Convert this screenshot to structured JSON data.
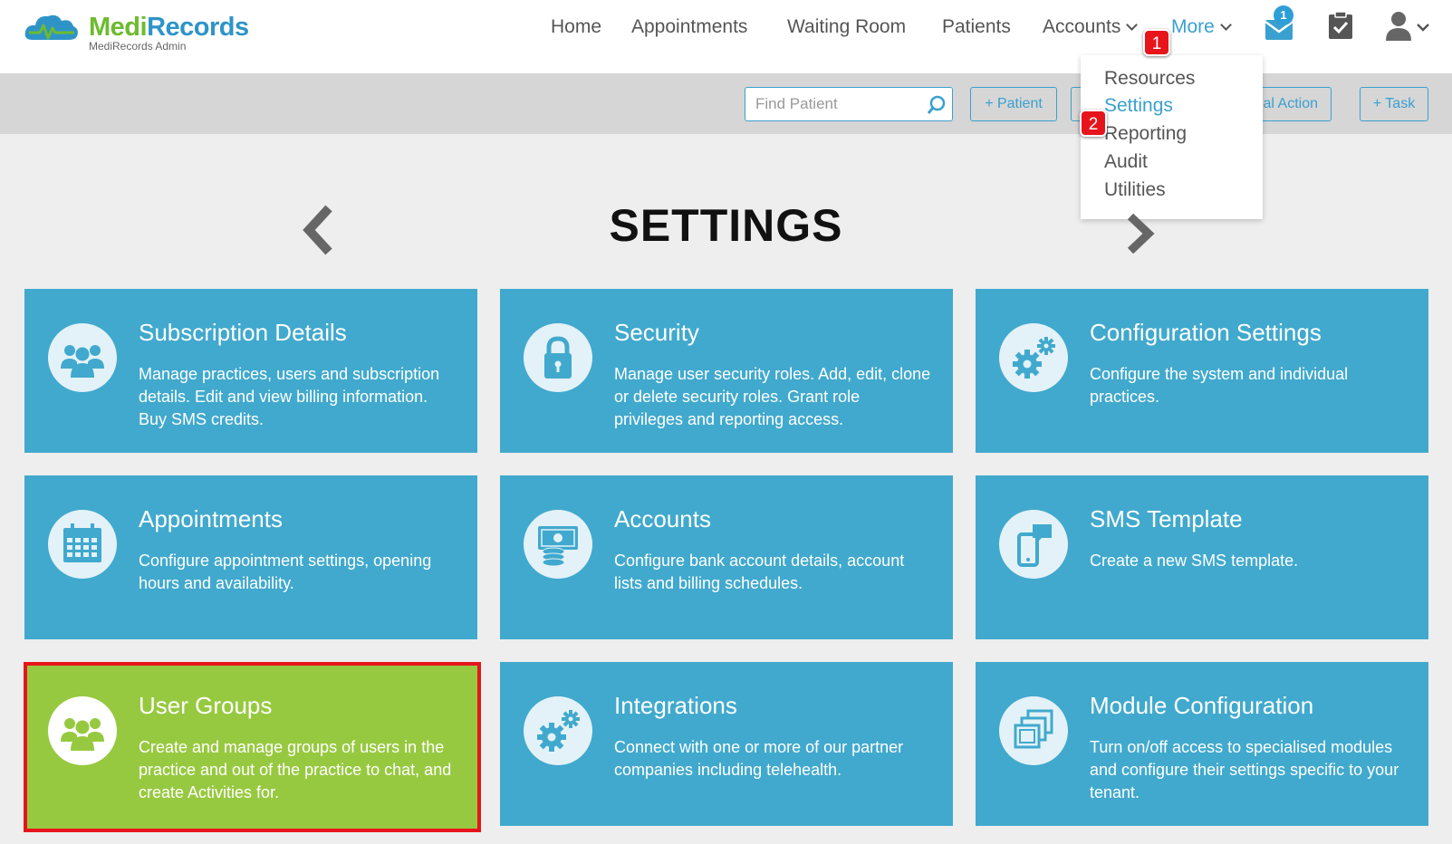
{
  "header": {
    "logo": {
      "name_part1": "Medi",
      "name_part2": "Records",
      "subtitle": "MediRecords Admin"
    },
    "nav": [
      {
        "label": "Home"
      },
      {
        "label": "Appointments"
      },
      {
        "label": "Waiting Room"
      },
      {
        "label": "Patients"
      },
      {
        "label": "Accounts"
      },
      {
        "label": "More",
        "active": true
      }
    ],
    "messages_count": "1",
    "step_badges": [
      "1",
      "2"
    ]
  },
  "toolbar": {
    "search_placeholder": "Find Patient",
    "buttons": [
      {
        "label": "+ Patient"
      },
      {
        "label": "ical Action"
      },
      {
        "label": "+ Task"
      }
    ]
  },
  "dropdown": {
    "items": [
      {
        "label": "Resources"
      },
      {
        "label": "Settings",
        "active": true
      },
      {
        "label": "Reporting"
      },
      {
        "label": "Audit"
      },
      {
        "label": "Utilities"
      }
    ]
  },
  "page": {
    "title": "SETTINGS"
  },
  "cards": [
    {
      "title": "Subscription Details",
      "desc": "Manage practices, users and subscription details. Edit and view billing information. Buy SMS credits.",
      "icon": "users-icon"
    },
    {
      "title": "Security",
      "desc": "Manage user security roles. Add, edit, clone or delete security roles. Grant role privileges and reporting access.",
      "icon": "lock-icon"
    },
    {
      "title": "Configuration Settings",
      "desc": "Configure the system and individual practices.",
      "icon": "gears-icon"
    },
    {
      "title": "Appointments",
      "desc": "Configure appointment settings, opening hours and availability.",
      "icon": "calendar-icon"
    },
    {
      "title": "Accounts",
      "desc": "Configure bank account details, account lists and billing schedules.",
      "icon": "money-icon"
    },
    {
      "title": "SMS Template",
      "desc": "Create a new SMS template.",
      "icon": "phone-message-icon"
    },
    {
      "title": "User Groups",
      "desc": "Create and manage groups of users in the practice and out of the practice to chat, and create Activities for.",
      "icon": "users-icon",
      "highlighted": true
    },
    {
      "title": "Integrations",
      "desc": "Connect with one or more of our partner companies including telehealth.",
      "icon": "gears-icon"
    },
    {
      "title": "Module Configuration",
      "desc": "Turn on/off access to specialised modules and configure their settings specific to your tenant.",
      "icon": "stacked-windows-icon"
    }
  ],
  "colors": {
    "card_blue": "#41a9cd",
    "card_green": "#97c940",
    "accent": "#3aa0cf",
    "highlight_red": "#e8141c"
  }
}
